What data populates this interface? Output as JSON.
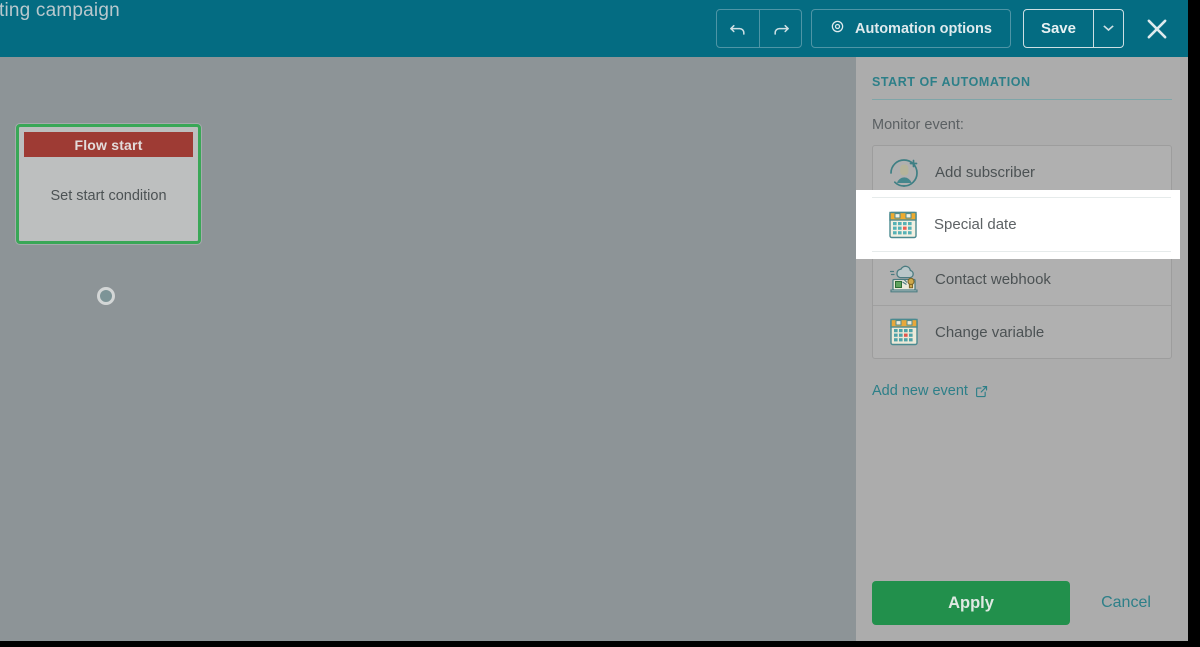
{
  "window": {
    "title": "rketing campaign"
  },
  "toolbar": {
    "undo_icon": "undo-icon",
    "redo_icon": "redo-icon",
    "automation_options_label": "Automation options",
    "automation_options_icon": "gear-icon",
    "save_label": "Save",
    "save_caret_icon": "chevron-down-icon",
    "close_icon": "close-icon"
  },
  "canvas": {
    "node": {
      "header": "Flow start",
      "body": "Set start condition"
    }
  },
  "panel": {
    "title": "START OF AUTOMATION",
    "monitor_label": "Monitor event:",
    "events": [
      {
        "label": "Add subscriber",
        "icon": "add-subscriber-icon"
      },
      {
        "label": "Special date",
        "icon": "calendar-icon"
      },
      {
        "label": "Contact webhook",
        "icon": "webhook-icon"
      },
      {
        "label": "Change variable",
        "icon": "calendar-icon"
      }
    ],
    "highlighted_event": "Special date",
    "add_new_event_label": "Add new event",
    "add_new_event_icon": "external-link-icon",
    "apply_label": "Apply",
    "cancel_label": "Cancel"
  },
  "colors": {
    "header_bg": "#046c82",
    "accent_teal": "#2d7f88",
    "apply_green": "#22904c",
    "node_border_green": "#3aa757",
    "node_header_red": "#9e3b34",
    "dim_canvas": "#8d9497",
    "dim_panel": "#acacac"
  }
}
